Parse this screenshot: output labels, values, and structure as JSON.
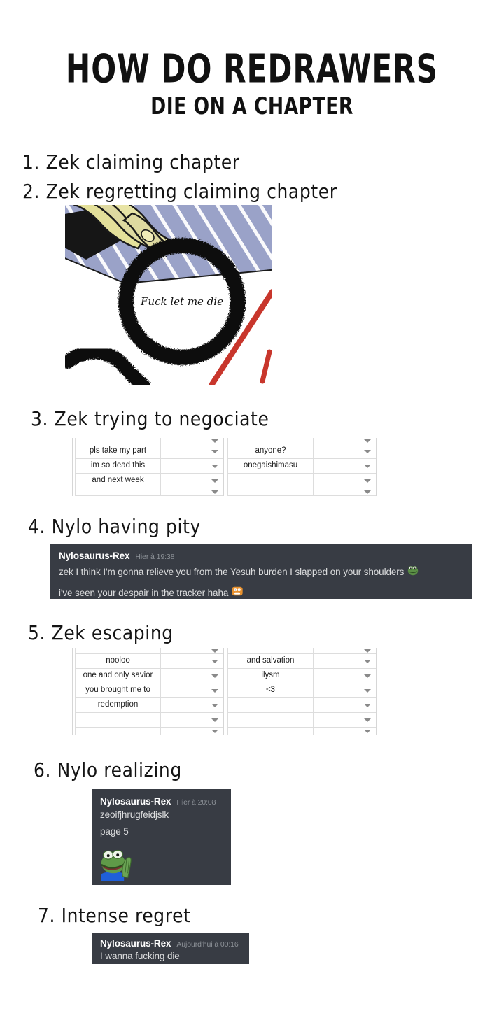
{
  "title": {
    "main": "HOW DO REDRAWERS",
    "sub": "DIE ON A CHAPTER"
  },
  "steps": [
    {
      "num": "1.",
      "label": "1. Zek claiming chapter"
    },
    {
      "num": "2.",
      "label": "2. Zek regretting claiming chapter"
    },
    {
      "num": "3.",
      "label": "3. Zek trying to negociate"
    },
    {
      "num": "4.",
      "label": "4. Nylo having pity"
    },
    {
      "num": "5.",
      "label": "5. Zek escaping"
    },
    {
      "num": "6.",
      "label": "6. Nylo realizing"
    },
    {
      "num": "7.",
      "label": "7. Intense regret"
    }
  ],
  "manga_panel": {
    "speech_text": "Fuck let me die",
    "colors": {
      "paper_blue": "#9aa2c8",
      "paper_stripe": "#ffffff",
      "hand_yellow": "#e4e09a",
      "hand_outline": "#1a1a1a",
      "red_stroke": "#c8362c",
      "ink_black": "#111111"
    }
  },
  "spreadsheet_negotiate": {
    "left_column": [
      "pls take my part",
      "im so dead this",
      "and next week",
      ""
    ],
    "right_column": [
      "anyone?",
      "onegaishimasu",
      "",
      ""
    ],
    "dropdown_icon": "chevron-down-icon"
  },
  "spreadsheet_escaping": {
    "left_column": [
      "nooloo",
      "one and only savior",
      "you brought me to",
      "redemption",
      "",
      ""
    ],
    "right_column": [
      "and salvation",
      "ilysm",
      "<3",
      "",
      "",
      ""
    ],
    "dropdown_icon": "chevron-down-icon"
  },
  "discord_pity": {
    "author": "Nylosaurus-Rex",
    "timestamp": "Hier à 19:38",
    "lines": [
      {
        "text": "zek I think I'm gonna relieve you from the Yesuh burden I slapped on your shoulders",
        "emoji": "pepe-frog-emoji"
      },
      {
        "text": "i've seen your despair in the tracker haha",
        "emoji": "orange-blob-emoji"
      }
    ]
  },
  "discord_realizing": {
    "author": "Nylosaurus-Rex",
    "timestamp": "Hier à 20:08",
    "lines": [
      {
        "text": "zeoifjhrugfeidjslk"
      },
      {
        "text": "page 5"
      }
    ],
    "attachment": "pepe-frog-praying-image"
  },
  "discord_regret": {
    "author": "Nylosaurus-Rex",
    "timestamp": "Aujourd'hui à 00:16",
    "lines": [
      {
        "text": "I wanna fucking die"
      }
    ]
  },
  "colors": {
    "discord_bg": "#383c44",
    "discord_text": "#dcddde",
    "discord_muted": "#8d9298",
    "page_bg": "#ffffff",
    "ink": "#141414"
  }
}
